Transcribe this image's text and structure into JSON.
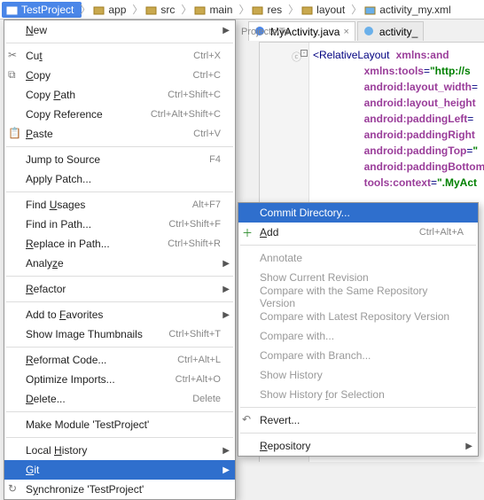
{
  "breadcrumb": [
    {
      "label": "TestProject",
      "selected": true,
      "icon": "folder"
    },
    {
      "label": "app",
      "icon": "folder"
    },
    {
      "label": "src",
      "icon": "folder"
    },
    {
      "label": "main",
      "icon": "folder"
    },
    {
      "label": "res",
      "icon": "folder"
    },
    {
      "label": "layout",
      "icon": "folder"
    },
    {
      "label": "activity_my.xml",
      "icon": "xml"
    }
  ],
  "path_hint": "Projects\\Te",
  "editor_tabs": [
    {
      "label": "MyActivity.java",
      "icon": "class",
      "active": true,
      "close": "×"
    },
    {
      "label": "activity_",
      "icon": "xml",
      "active": false
    }
  ],
  "code": {
    "open_tag": "<",
    "root": "RelativeLayout",
    "lines": [
      {
        "attr": "xmlns:and",
        "after": ""
      },
      {
        "attr": "xmlns:tools",
        "after": "=",
        "val": "\"http://s"
      },
      {
        "attr": "android:layout_width",
        "after": "="
      },
      {
        "attr": "android:layout_height",
        "after": ""
      },
      {
        "attr": "android:paddingLeft",
        "after": "="
      },
      {
        "attr": "android:paddingRight",
        "after": ""
      },
      {
        "attr": "android:paddingTop",
        "after": "=",
        "val": "\""
      },
      {
        "attr": "android:paddingBottom",
        "after": ""
      },
      {
        "attr": "tools:context",
        "after": "=",
        "val": "\".MyAct"
      }
    ]
  },
  "context_menu": [
    {
      "label": "New",
      "arrow": true
    },
    {
      "sep": true
    },
    {
      "label": "Cut",
      "sc": "Ctrl+X",
      "icon": "cut"
    },
    {
      "label": "Copy",
      "sc": "Ctrl+C",
      "icon": "copy"
    },
    {
      "label": "Copy Path",
      "sc": "Ctrl+Shift+C"
    },
    {
      "label": "Copy Reference",
      "sc": "Ctrl+Alt+Shift+C"
    },
    {
      "label": "Paste",
      "sc": "Ctrl+V",
      "icon": "paste"
    },
    {
      "sep": true
    },
    {
      "label": "Jump to Source",
      "sc": "F4"
    },
    {
      "label": "Apply Patch..."
    },
    {
      "sep": true
    },
    {
      "label": "Find Usages",
      "sc": "Alt+F7"
    },
    {
      "label": "Find in Path...",
      "sc": "Ctrl+Shift+F"
    },
    {
      "label": "Replace in Path...",
      "sc": "Ctrl+Shift+R"
    },
    {
      "label": "Analyze",
      "arrow": true
    },
    {
      "sep": true
    },
    {
      "label": "Refactor",
      "arrow": true
    },
    {
      "sep": true
    },
    {
      "label": "Add to Favorites",
      "arrow": true
    },
    {
      "label": "Show Image Thumbnails",
      "sc": "Ctrl+Shift+T"
    },
    {
      "sep": true
    },
    {
      "label": "Reformat Code...",
      "sc": "Ctrl+Alt+L"
    },
    {
      "label": "Optimize Imports...",
      "sc": "Ctrl+Alt+O"
    },
    {
      "label": "Delete...",
      "sc": "Delete"
    },
    {
      "sep": true
    },
    {
      "label": "Make Module 'TestProject'"
    },
    {
      "sep": true
    },
    {
      "label": "Local History",
      "arrow": true
    },
    {
      "label": "Git",
      "arrow": true,
      "highlight": true
    },
    {
      "label": "Synchronize 'TestProject'",
      "icon": "sync"
    }
  ],
  "git_submenu": [
    {
      "label": "Commit Directory...",
      "highlight": true
    },
    {
      "label": "Add",
      "sc": "Ctrl+Alt+A",
      "icon": "plus"
    },
    {
      "sep": true
    },
    {
      "label": "Annotate",
      "disabled": true
    },
    {
      "label": "Show Current Revision",
      "disabled": true
    },
    {
      "label": "Compare with the Same Repository Version",
      "disabled": true
    },
    {
      "label": "Compare with Latest Repository Version",
      "disabled": true
    },
    {
      "label": "Compare with...",
      "disabled": true
    },
    {
      "label": "Compare with Branch...",
      "disabled": true
    },
    {
      "label": "Show History",
      "disabled": true
    },
    {
      "label": "Show History for Selection",
      "disabled": true
    },
    {
      "sep": true
    },
    {
      "label": "Revert...",
      "icon": "revert"
    },
    {
      "sep": true
    },
    {
      "label": "Repository",
      "arrow": true
    }
  ],
  "colors": {
    "highlight": "#2f6fcd",
    "attr_purple": "#9a3d9a",
    "val_green": "#008000"
  }
}
